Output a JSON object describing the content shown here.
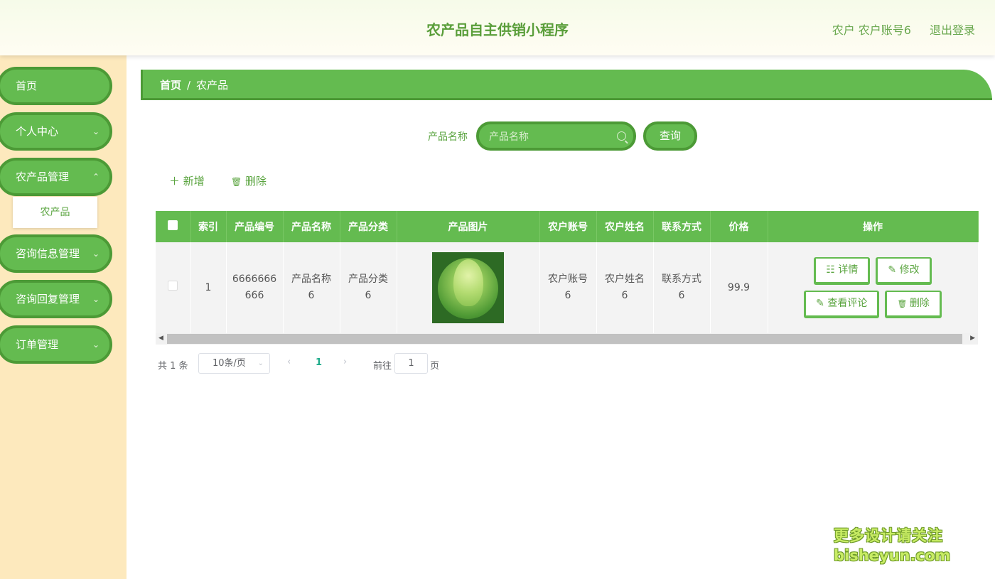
{
  "header": {
    "title": "农产品自主供销小程序",
    "user": "农户 农户账号6",
    "logout": "退出登录"
  },
  "sidebar": {
    "items": [
      {
        "label": "首页",
        "has_children": false
      },
      {
        "label": "个人中心",
        "has_children": true
      },
      {
        "label": "农产品管理",
        "has_children": true,
        "expanded": true,
        "children": [
          "农产品"
        ]
      },
      {
        "label": "咨询信息管理",
        "has_children": true
      },
      {
        "label": "咨询回复管理",
        "has_children": true
      },
      {
        "label": "订单管理",
        "has_children": true
      }
    ],
    "chevron": "⌄"
  },
  "breadcrumb": {
    "home": "首页",
    "separator": "/",
    "current": "农产品"
  },
  "search": {
    "label": "产品名称",
    "placeholder": "产品名称",
    "value": "",
    "button": "查询"
  },
  "actions": {
    "add": "新增",
    "add_icon": "＋",
    "delete": "删除",
    "delete_icon": "🗑"
  },
  "table": {
    "columns": [
      "",
      "索引",
      "产品编号",
      "产品名称",
      "产品分类",
      "产品图片",
      "农户账号",
      "农户姓名",
      "联系方式",
      "价格",
      "操作"
    ],
    "rows": [
      {
        "index": "1",
        "code_line1": "6666666",
        "code_line2": "666",
        "name_line1": "产品名称",
        "name_line2": "6",
        "category_line1": "产品分类",
        "category_line2": "6",
        "image": "cabbage",
        "account_line1": "农户账号",
        "account_line2": "6",
        "farmer_line1": "农户姓名",
        "farmer_line2": "6",
        "contact_line1": "联系方式",
        "contact_line2": "6",
        "price": "99.9",
        "ops": {
          "detail": "详情",
          "edit": "修改",
          "comments": "查看评论",
          "delete": "删除"
        }
      }
    ]
  },
  "pagination": {
    "total": "共 1 条",
    "page_size": "10条/页",
    "current_page": "1",
    "goto_label": "前往",
    "goto_value": "1",
    "page_unit": "页"
  },
  "watermark": {
    "line1": "更多设计请关注",
    "line2": "bisheyun.com"
  },
  "colors": {
    "primary": "#64bb50",
    "primary_dark": "#4c9a36",
    "sidebar_bg": "#fde9bd",
    "title": "#5a9e3a",
    "page_active": "#1dab8a"
  }
}
